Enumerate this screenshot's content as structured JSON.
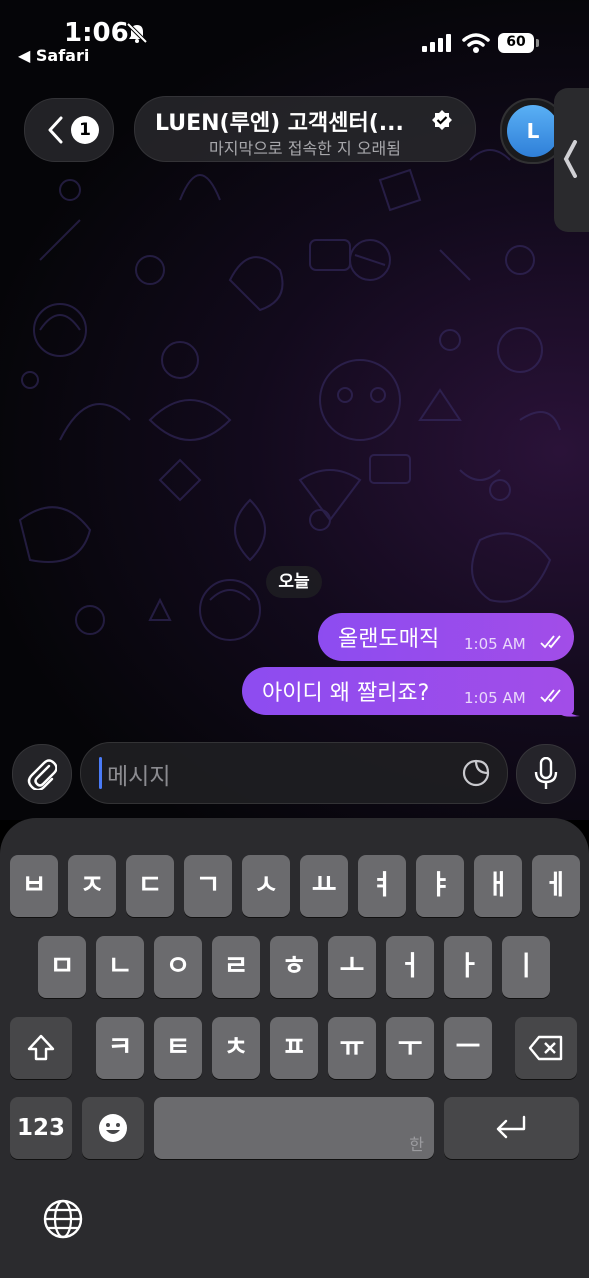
{
  "status_bar": {
    "time": "1:06",
    "back_app": "◀ Safari",
    "battery": "60"
  },
  "header": {
    "back_badge": "1",
    "title": "LUEN(루엔) 고객센터(...",
    "subtitle": "마지막으로 접속한 지 오래됨",
    "avatar_letter": "L"
  },
  "chat": {
    "date_chip": "오늘",
    "messages": [
      {
        "text": "올랜도매직",
        "time": "1:05 AM"
      },
      {
        "text": "아이디 왜 짤리죠?",
        "time": "1:05 AM"
      }
    ]
  },
  "composer": {
    "placeholder": "메시지"
  },
  "keyboard": {
    "row1": [
      "ㅂ",
      "ㅈ",
      "ㄷ",
      "ㄱ",
      "ㅅ",
      "ㅛ",
      "ㅕ",
      "ㅑ",
      "ㅐ",
      "ㅔ"
    ],
    "row2": [
      "ㅁ",
      "ㄴ",
      "ㅇ",
      "ㄹ",
      "ㅎ",
      "ㅗ",
      "ㅓ",
      "ㅏ",
      "ㅣ"
    ],
    "row3": [
      "ㅋ",
      "ㅌ",
      "ㅊ",
      "ㅍ",
      "ㅠ",
      "ㅜ",
      "ㅡ"
    ],
    "numbers_key": "123",
    "space_label": "한"
  },
  "colors": {
    "bubble": "#9b4dea",
    "keyboard_bg": "#2b2b2e",
    "key": "#6b6b6e"
  }
}
